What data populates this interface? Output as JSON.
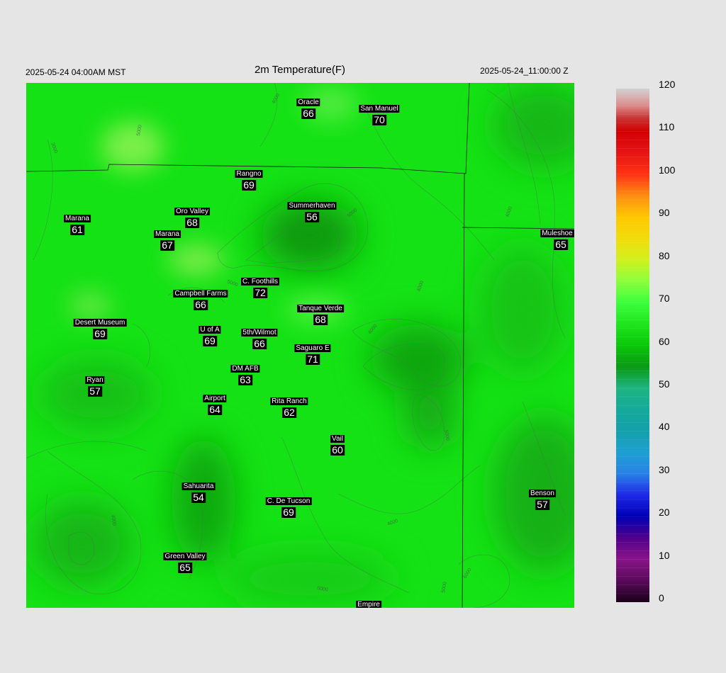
{
  "header": {
    "local_time": "2025-05-24 04:00AM MST",
    "title": "2m Temperature(F)",
    "utc_time": "2025-05-24_11:00:00 Z"
  },
  "stations": [
    {
      "name": "Oracle",
      "value": "66"
    },
    {
      "name": "San Manuel",
      "value": "70"
    },
    {
      "name": "Rangno",
      "value": "69"
    },
    {
      "name": "Marana",
      "value": "61"
    },
    {
      "name": "Oro Valley",
      "value": "68"
    },
    {
      "name": "Summerhaven",
      "value": "56"
    },
    {
      "name": "Marana",
      "value": "67"
    },
    {
      "name": "Muleshoe R",
      "value": "65"
    },
    {
      "name": "C. Foothills",
      "value": "72"
    },
    {
      "name": "Campbell Farms",
      "value": "66"
    },
    {
      "name": "Tanque Verde",
      "value": "68"
    },
    {
      "name": "Desert Museum",
      "value": "69"
    },
    {
      "name": "U of A",
      "value": "69"
    },
    {
      "name": "5th/Wilmot",
      "value": "66"
    },
    {
      "name": "Saguaro E",
      "value": "71"
    },
    {
      "name": "DM AFB",
      "value": "63"
    },
    {
      "name": "Ryan",
      "value": "57"
    },
    {
      "name": "Airport",
      "value": "64"
    },
    {
      "name": "Rita Ranch",
      "value": "62"
    },
    {
      "name": "Vail",
      "value": "60"
    },
    {
      "name": "Sahuarita",
      "value": "54"
    },
    {
      "name": "C. De Tucson",
      "value": "69"
    },
    {
      "name": "Benson",
      "value": "57"
    },
    {
      "name": "Green Valley",
      "value": "65"
    },
    {
      "name": "Empire",
      "value": ""
    }
  ],
  "contour_labels": [
    "4000",
    "5000",
    "3000",
    "6000"
  ],
  "colorbar": {
    "min": 0,
    "max": 120,
    "ticks": [
      "0",
      "10",
      "20",
      "30",
      "40",
      "50",
      "60",
      "70",
      "80",
      "90",
      "100",
      "110",
      "120"
    ],
    "stops": [
      {
        "v": 0,
        "c": "#1a001a"
      },
      {
        "v": 5,
        "c": "#5a0a5a"
      },
      {
        "v": 10,
        "c": "#8a148a"
      },
      {
        "v": 15,
        "c": "#50008c"
      },
      {
        "v": 20,
        "c": "#0000b4"
      },
      {
        "v": 25,
        "c": "#1e28e6"
      },
      {
        "v": 30,
        "c": "#2882e6"
      },
      {
        "v": 35,
        "c": "#1ea0d2"
      },
      {
        "v": 40,
        "c": "#14a0aa"
      },
      {
        "v": 45,
        "c": "#14aa9a"
      },
      {
        "v": 50,
        "c": "#1eb482"
      },
      {
        "v": 55,
        "c": "#0a9a14"
      },
      {
        "v": 60,
        "c": "#0ac80a"
      },
      {
        "v": 65,
        "c": "#1ee61e"
      },
      {
        "v": 70,
        "c": "#3cff3c"
      },
      {
        "v": 75,
        "c": "#8cff3c"
      },
      {
        "v": 80,
        "c": "#d2f01e"
      },
      {
        "v": 85,
        "c": "#f0dc0a"
      },
      {
        "v": 90,
        "c": "#ffc800"
      },
      {
        "v": 95,
        "c": "#ff8c14"
      },
      {
        "v": 100,
        "c": "#ff3214"
      },
      {
        "v": 105,
        "c": "#e61414"
      },
      {
        "v": 110,
        "c": "#d20000"
      },
      {
        "v": 113,
        "c": "#c83232"
      },
      {
        "v": 116,
        "c": "#dc8c8c"
      },
      {
        "v": 120,
        "c": "#d2d2d2"
      }
    ]
  }
}
